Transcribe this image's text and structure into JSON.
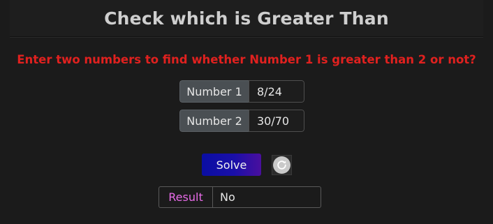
{
  "header": {
    "title": "Check which is Greater Than"
  },
  "prompt": {
    "text": "Enter two numbers to find whether Number 1 is greater than 2 or not?"
  },
  "inputs": {
    "number1": {
      "label": "Number 1",
      "value": "8/24"
    },
    "number2": {
      "label": "Number 2",
      "value": "30/70"
    }
  },
  "buttons": {
    "solve_label": "Solve",
    "reset_icon": "refresh-icon"
  },
  "result": {
    "label": "Result",
    "value": "No"
  },
  "colors": {
    "prompt": "#e0211f",
    "result_label": "#e86be8",
    "solve_gradient_start": "#0a0ea3",
    "solve_gradient_end": "#4a0f9e"
  }
}
